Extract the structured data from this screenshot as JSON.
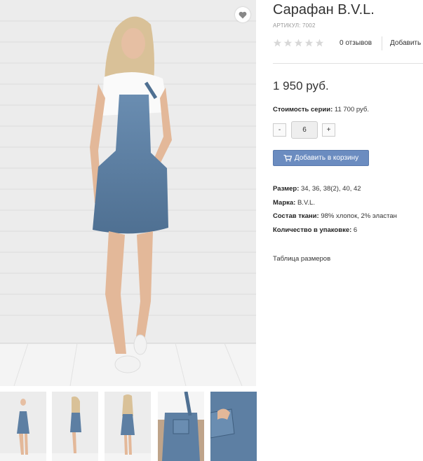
{
  "product": {
    "title": "Сарафан B.V.L.",
    "sku": "АРТИКУЛ: 7002",
    "rating_stars": 0,
    "reviews": "0 отзывов",
    "add_review": "Добавить",
    "price": "1 950 руб.",
    "series_label": "Стоимость серии:",
    "series_value": "11 700 руб.",
    "qty_minus": "-",
    "qty_value": "6",
    "qty_plus": "+",
    "add_to_cart": "Добавить в корзину",
    "attributes": [
      {
        "label": "Размер:",
        "value": "34, 36, 38(2), 40, 42"
      },
      {
        "label": "Марка:",
        "value": "B.V.L."
      },
      {
        "label": "Состав ткани:",
        "value": "98% хлопок, 2% эластан"
      },
      {
        "label": "Количество в упаковке:",
        "value": "6"
      }
    ],
    "size_table_link": "Таблица размеров"
  },
  "gallery": {
    "thumbnails": [
      "front-view",
      "side-view",
      "back-view",
      "bib-detail",
      "pocket-detail"
    ]
  },
  "colors": {
    "accent": "#6b8cc0",
    "denim": "#5d7fa3",
    "wall": "#e9e9e9"
  }
}
